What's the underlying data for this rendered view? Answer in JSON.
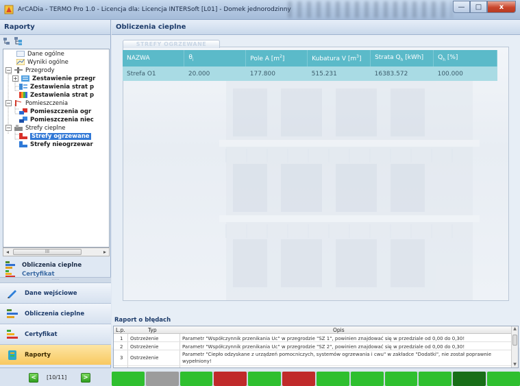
{
  "window": {
    "title": "ArCADia - TERMO Pro 1.0 - Licencja dla: Licencja INTERSoft [L01] - Domek jednorodzinny",
    "buttons": {
      "minimize": "—",
      "maximize": "□",
      "close": "x"
    }
  },
  "left_panel": {
    "header": "Raporty",
    "tree": [
      {
        "label": "Dane ogólne",
        "icon": "sheet-icon"
      },
      {
        "label": "Wyniki ogólne",
        "icon": "chart-icon"
      },
      {
        "label": "Przegrody",
        "icon": "wall-icon"
      },
      {
        "label": "Zestawienie przegr",
        "icon": "bars-icon"
      },
      {
        "label": "Zestawienia strat p",
        "icon": "bars-icon"
      },
      {
        "label": "Zestawienia strat p",
        "icon": "rainbow-icon"
      },
      {
        "label": "Pomieszczenia",
        "icon": "room-icon"
      },
      {
        "label": "Pomieszczenia ogr",
        "icon": "room-red-icon"
      },
      {
        "label": "Pomieszczenia niec",
        "icon": "room-blue-icon"
      },
      {
        "label": "Strefy cieplne",
        "icon": "zone-icon"
      },
      {
        "label": "Strefy ogrzewane",
        "icon": "zone-red-icon"
      },
      {
        "label": "Strefy nieogrzewar",
        "icon": "zone-blue-icon"
      }
    ],
    "scroll_thumb": "III",
    "mini_items": [
      {
        "label": "Obliczenia cieplne"
      },
      {
        "label": "Certyfikat"
      }
    ],
    "grip": "·····",
    "nav": [
      {
        "label": "Dane wejściowe",
        "icon": "pencil-icon"
      },
      {
        "label": "Obliczenia cieplne",
        "icon": "calc-bars-icon"
      },
      {
        "label": "Certyfikat",
        "icon": "certificate-icon"
      },
      {
        "label": "Raporty",
        "icon": "report-icon"
      }
    ],
    "pager": {
      "text": "[10/11]",
      "prev": "<",
      "next": ">"
    }
  },
  "main": {
    "header": "Obliczenia cieplne",
    "tab": "STREFY OGRZEWANE",
    "table": {
      "headers": [
        "NAZWA",
        "θ",
        "Pole A [m",
        "Kubatura V [m",
        "Strata Q",
        "Q"
      ],
      "header_subs": [
        "",
        "i",
        "2",
        "3",
        "h",
        "h"
      ],
      "header_tails": [
        "",
        "",
        "]",
        "]",
        " [kWh]",
        " [%]"
      ],
      "rows": [
        [
          "Strefa O1",
          "20.000",
          "177.800",
          "515.231",
          "16383.572",
          "100.000"
        ]
      ]
    },
    "errors": {
      "title": "Raport o błędach",
      "headers": [
        "L.p.",
        "Typ",
        "Opis"
      ],
      "rows": [
        [
          "1",
          "Ostrzeżenie",
          "Parametr \"Współczynnik przenikania Uc\" w przegrodzie \"SZ 1\", powinien znajdować się w przedziale od 0,00 do 0,30!"
        ],
        [
          "2",
          "Ostrzeżenie",
          "Parametr \"Współczynnik przenikania Uc\" w przegrodzie \"SZ 2\", powinien znajdować się w przedziale od 0,00 do 0,30!"
        ],
        [
          "3",
          "Ostrzeżenie",
          "Parametr \"Ciepło odzyskane z urządzeń pomocniczych, systemów ogrzewania i cwu\" w zakładce \"Dodatki\", nie został poprawnie",
          "wypełniony!"
        ]
      ]
    }
  },
  "status_colors": [
    "#2fbf2f",
    "#9c9c9c",
    "#2fbf2f",
    "#c02a2a",
    "#2fbf2f",
    "#c02a2a",
    "#2fbf2f",
    "#2fbf2f",
    "#2fbf2f",
    "#2fbf2f",
    "#186e18",
    "#2fbf2f"
  ]
}
